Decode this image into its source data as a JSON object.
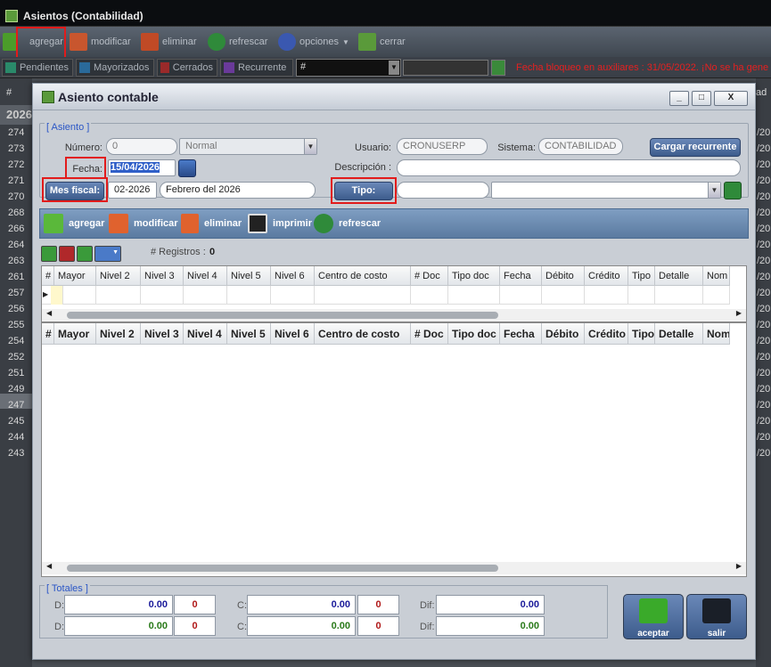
{
  "app": {
    "title": "Asientos (Contabilidad)"
  },
  "main_toolbar": {
    "agregar": "agregar",
    "modificar": "modificar",
    "eliminar": "eliminar",
    "refrescar": "refrescar",
    "opciones": "opciones",
    "cerrar": "cerrar"
  },
  "status_tabs": {
    "pendientes": "Pendientes",
    "mayorizados": "Mayorizados",
    "cerrados": "Cerrados",
    "recurrente": "Recurrente",
    "hash_field": "#"
  },
  "notice": "Fecha bloqueo en auxiliares : 31/05/2022.  ¡No se ha gene",
  "background_list": {
    "header": "#",
    "year": "2026",
    "rows": [
      "274",
      "273",
      "272",
      "271",
      "270",
      "268",
      "266",
      "264",
      "263",
      "261",
      "257",
      "256",
      "255",
      "254",
      "252",
      "251",
      "249",
      "247",
      "245",
      "244",
      "243"
    ],
    "right_fragment": "/20",
    "right_header": "ad"
  },
  "dialog": {
    "title": "Asiento contable",
    "window_buttons": {
      "minimize": "_",
      "maximize": "□",
      "close": "X"
    },
    "asiento": {
      "legend": "[ Asiento ]",
      "numero_label": "Número:",
      "numero_value": "0",
      "tipo_select_value": "Normal",
      "usuario_label": "Usuario:",
      "usuario_value": "CRONUSERP",
      "sistema_label": "Sistema:",
      "sistema_value": "CONTABILIDAD",
      "cargar_button": "Cargar recurrente",
      "fecha_label": "Fecha:",
      "fecha_value": "15/04/2026",
      "descripcion_label": "Descripción :",
      "descripcion_value": "",
      "mes_fiscal_button": "Mes fiscal:",
      "mes_value": "02-2026",
      "mes_text": "Febrero del 2026",
      "tipo_button": "Tipo:",
      "tipo_value": "",
      "tipo_select": ""
    },
    "inner_toolbar": {
      "agregar": "agregar",
      "modificar": "modificar",
      "eliminar": "eliminar",
      "imprimir": "imprimir",
      "refrescar": "refrescar"
    },
    "registros_label": "# Registros :",
    "registros_value": "0",
    "columns": [
      "#",
      "Mayor",
      "Nivel 2",
      "Nivel 3",
      "Nivel 4",
      "Nivel 5",
      "Nivel 6",
      "Centro de costo",
      "# Doc",
      "Tipo doc",
      "Fecha",
      "Débito",
      "Crédito",
      "Tipo",
      "Detalle",
      "Nom"
    ],
    "totales": {
      "legend": "[ Totales ]",
      "d_label": "D:",
      "c_label": "C:",
      "dif_label": "Dif:",
      "d1_value": "0.00",
      "d1_count": "0",
      "d2_value": "0.00",
      "d2_count": "0",
      "c1_value": "0.00",
      "c1_count": "0",
      "c2_value": "0.00",
      "c2_count": "0",
      "dif1_value": "0.00",
      "dif2_value": "0.00"
    },
    "aceptar": "aceptar",
    "salir": "salir"
  }
}
